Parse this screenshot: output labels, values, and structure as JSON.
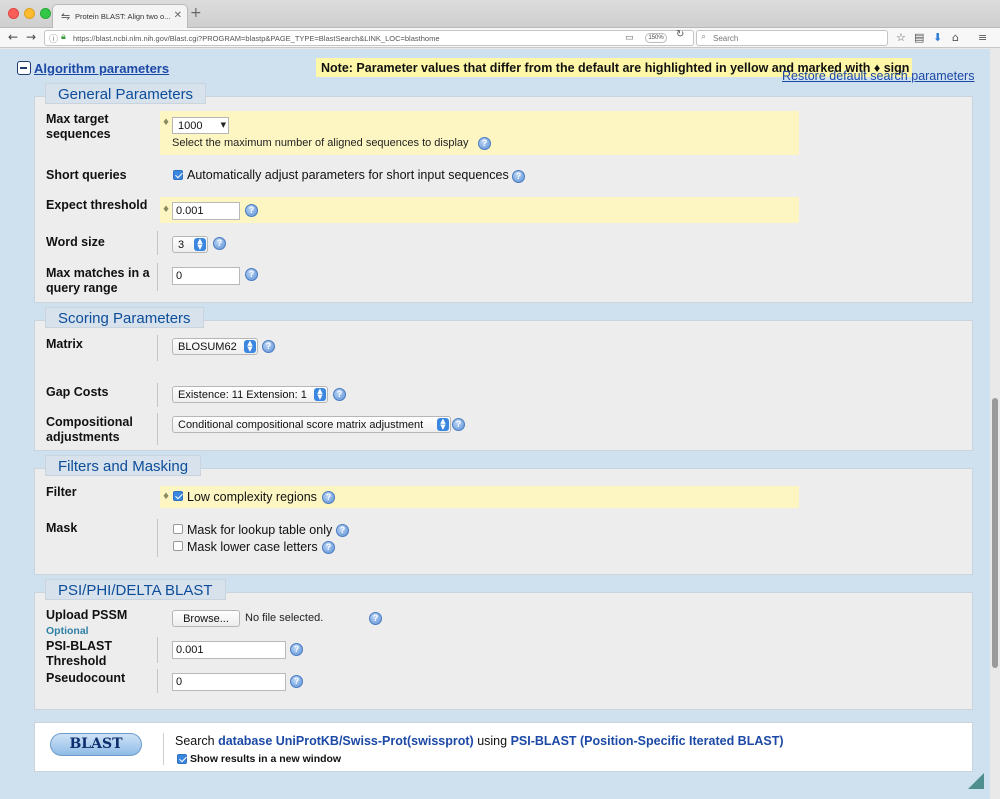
{
  "browser": {
    "tab_title": "Protein BLAST: Align two o...",
    "url": "https://blast.ncbi.nlm.nih.gov/Blast.cgi?PROGRAM=blastp&PAGE_TYPE=BlastSearch&LINK_LOC=blasthome",
    "zoom": "150%",
    "search_placeholder": "Search"
  },
  "header": {
    "algo_link": "Algorithm parameters",
    "note": "Note: Parameter values that differ from the default are highlighted in yellow and marked with ♦ sign",
    "restore_link": "Restore default search parameters"
  },
  "general": {
    "title": "General Parameters",
    "max_target_label": "Max target sequences",
    "max_target_value": "1000",
    "max_target_hint": "Select the maximum number of aligned sequences to display",
    "short_queries_label": "Short queries",
    "short_queries_text": "Automatically adjust parameters for short input sequences",
    "expect_label": "Expect threshold",
    "expect_value": "0.001",
    "word_size_label": "Word size",
    "word_size_value": "3",
    "max_matches_label": "Max matches in a query range",
    "max_matches_value": "0"
  },
  "scoring": {
    "title": "Scoring Parameters",
    "matrix_label": "Matrix",
    "matrix_value": "BLOSUM62",
    "gap_label": "Gap Costs",
    "gap_value": "Existence: 11 Extension: 1",
    "comp_label": "Compositional adjustments",
    "comp_value": "Conditional compositional score matrix adjustment"
  },
  "filters": {
    "title": "Filters and Masking",
    "filter_label": "Filter",
    "low_complexity": "Low complexity regions",
    "mask_label": "Mask",
    "mask_lookup": "Mask for lookup table only",
    "mask_lower": "Mask lower case letters"
  },
  "psi": {
    "title": "PSI/PHI/DELTA BLAST",
    "upload_label": "Upload PSSM",
    "optional": "Optional",
    "browse": "Browse...",
    "no_file": "No file selected.",
    "threshold_label": "PSI-BLAST Threshold",
    "threshold_value": "0.001",
    "pseudocount_label": "Pseudocount",
    "pseudocount_value": "0"
  },
  "bottom": {
    "blast_button": "BLAST",
    "search_prefix": "Search",
    "database_link": "database UniProtKB/Swiss-Prot(swissprot)",
    "using": "using",
    "program_link": "PSI-BLAST (Position-Specific Iterated BLAST)",
    "new_window": "Show results in a new window"
  },
  "colors": {
    "highlight": "#fdf6c3",
    "link": "#1c49a6",
    "legend_text": "#0d4d99"
  }
}
